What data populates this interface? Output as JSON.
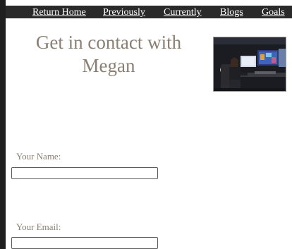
{
  "nav": {
    "items": [
      {
        "label": "Return Home"
      },
      {
        "label": "Previously"
      },
      {
        "label": "Currently"
      },
      {
        "label": "Blogs"
      },
      {
        "label": "Goals"
      }
    ]
  },
  "main": {
    "heading": "Get in contact with Megan",
    "photo_alt": "Megan seated at a gaming computer setup"
  },
  "form": {
    "name_label": "Your Name:",
    "name_value": "",
    "email_label": "Your Email:",
    "email_value": ""
  },
  "colors": {
    "nav_bg": "#2a2a2a",
    "heading": "#8a7f72",
    "page_bg": "#ffffff",
    "outer_bg": "#1f1f1f"
  }
}
